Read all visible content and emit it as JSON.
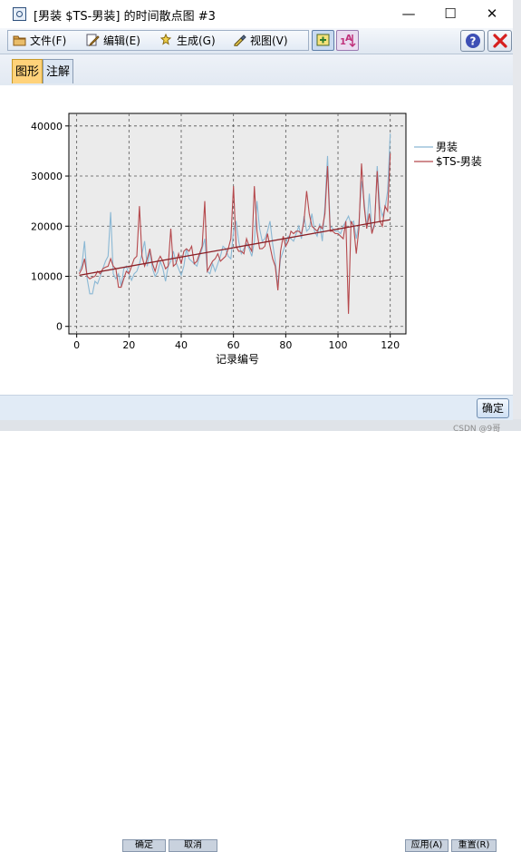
{
  "window": {
    "title": "[男装 $TS-男装] 的时间散点图 #3",
    "controls": {
      "minimize": "—",
      "maximize": "☐",
      "close": "✕"
    }
  },
  "menu": {
    "items": [
      {
        "label": "文件(F)",
        "icon": "folder-icon"
      },
      {
        "label": "编辑(E)",
        "icon": "edit-icon"
      },
      {
        "label": "生成(G)",
        "icon": "generate-icon"
      },
      {
        "label": "视图(V)",
        "icon": "view-icon"
      }
    ],
    "toolbar_buttons": [
      "chart-add-icon",
      "sort-icon"
    ],
    "help": "?",
    "close": "✕"
  },
  "tabs": [
    {
      "label": "图形",
      "active": true
    },
    {
      "label": "注解",
      "active": false
    }
  ],
  "chart_data": {
    "type": "line",
    "xlabel": "记录编号",
    "ylabel": "",
    "xlim": [
      -3,
      126
    ],
    "ylim": [
      -1500,
      42500
    ],
    "xticks": [
      0,
      20,
      40,
      60,
      80,
      100,
      120
    ],
    "yticks": [
      0,
      10000,
      20000,
      30000,
      40000
    ],
    "grid": true,
    "legend_position": "right",
    "series": [
      {
        "name": "男装",
        "color": "#8bb8d4",
        "x": [
          1,
          2,
          3,
          4,
          5,
          6,
          7,
          8,
          9,
          10,
          11,
          12,
          13,
          14,
          15,
          16,
          17,
          18,
          19,
          20,
          21,
          22,
          23,
          24,
          25,
          26,
          27,
          28,
          29,
          30,
          31,
          32,
          33,
          34,
          35,
          36,
          37,
          38,
          39,
          40,
          41,
          42,
          43,
          44,
          45,
          46,
          47,
          48,
          49,
          50,
          51,
          52,
          53,
          54,
          55,
          56,
          57,
          58,
          59,
          60,
          61,
          62,
          63,
          64,
          65,
          66,
          67,
          68,
          69,
          70,
          71,
          72,
          73,
          74,
          75,
          76,
          77,
          78,
          79,
          80,
          81,
          82,
          83,
          84,
          85,
          86,
          87,
          88,
          89,
          90,
          91,
          92,
          93,
          94,
          95,
          96,
          97,
          98,
          99,
          100,
          101,
          102,
          103,
          104,
          105,
          106,
          107,
          108,
          109,
          110,
          111,
          112,
          113,
          114,
          115,
          116,
          117,
          118,
          119,
          120
        ],
        "values": [
          11000,
          12200,
          17000,
          9500,
          6500,
          6500,
          9000,
          8500,
          10000,
          11500,
          13000,
          14000,
          22800,
          10500,
          9500,
          10500,
          8000,
          11500,
          12000,
          10500,
          9200,
          10500,
          11000,
          12500,
          14500,
          17000,
          12000,
          15000,
          11500,
          10000,
          10800,
          13000,
          11500,
          9000,
          12000,
          13000,
          15000,
          12800,
          11500,
          10200,
          12000,
          15500,
          13500,
          13000,
          12500,
          12000,
          14000,
          15500,
          17500,
          11000,
          10500,
          12500,
          11000,
          12500,
          14000,
          16000,
          15500,
          14000,
          13500,
          19000,
          21000,
          17000,
          14500,
          15500,
          16500,
          15500,
          14000,
          17000,
          25000,
          19500,
          17000,
          17500,
          19000,
          21000,
          16500,
          13000,
          8000,
          13500,
          15000,
          16500,
          18000,
          17500,
          17000,
          18500,
          20000,
          17500,
          22000,
          19000,
          19500,
          22500,
          19000,
          18000,
          20500,
          17000,
          24000,
          34000,
          20000,
          19500,
          19000,
          19000,
          18500,
          20000,
          21000,
          22000,
          20500,
          21000,
          17500,
          20500,
          29000,
          25000,
          19500,
          26500,
          19000,
          20000,
          32000,
          24000,
          22000,
          23500,
          27000,
          38500
        ]
      },
      {
        "name": "$TS-男装",
        "color": "#b5484c",
        "x": [
          1,
          2,
          3,
          4,
          5,
          6,
          7,
          8,
          9,
          10,
          11,
          12,
          13,
          14,
          15,
          16,
          17,
          18,
          19,
          20,
          21,
          22,
          23,
          24,
          25,
          26,
          27,
          28,
          29,
          30,
          31,
          32,
          33,
          34,
          35,
          36,
          37,
          38,
          39,
          40,
          41,
          42,
          43,
          44,
          45,
          46,
          47,
          48,
          49,
          50,
          51,
          52,
          53,
          54,
          55,
          56,
          57,
          58,
          59,
          60,
          61,
          62,
          63,
          64,
          65,
          66,
          67,
          68,
          69,
          70,
          71,
          72,
          73,
          74,
          75,
          76,
          77,
          78,
          79,
          80,
          81,
          82,
          83,
          84,
          85,
          86,
          87,
          88,
          89,
          90,
          91,
          92,
          93,
          94,
          95,
          96,
          97,
          98,
          99,
          100,
          101,
          102,
          103,
          104,
          105,
          106,
          107,
          108,
          109,
          110,
          111,
          112,
          113,
          114,
          115,
          116,
          117,
          118,
          119,
          120
        ],
        "values": [
          10500,
          11500,
          13500,
          10000,
          9500,
          9800,
          10000,
          11000,
          10500,
          11500,
          11800,
          12000,
          13500,
          12000,
          11500,
          7800,
          7800,
          9500,
          11000,
          10500,
          12000,
          13500,
          14000,
          24000,
          14000,
          12000,
          13500,
          15500,
          12500,
          11000,
          13000,
          14000,
          13000,
          11500,
          12000,
          19500,
          12000,
          12500,
          14500,
          12500,
          15000,
          15500,
          15000,
          16000,
          12500,
          13000,
          14500,
          16000,
          25000,
          11000,
          12000,
          13000,
          13500,
          14500,
          13000,
          13500,
          14000,
          15500,
          17500,
          28000,
          16000,
          15000,
          15000,
          14500,
          17500,
          16000,
          15000,
          28000,
          19000,
          15500,
          15500,
          16000,
          18500,
          16000,
          13500,
          12000,
          7200,
          15000,
          18000,
          16000,
          17000,
          19000,
          18500,
          19000,
          19000,
          18500,
          21000,
          27000,
          22500,
          20000,
          19500,
          19000,
          20000,
          19500,
          22500,
          32000,
          19000,
          19000,
          18500,
          18500,
          18000,
          17500,
          21000,
          2500,
          21000,
          20000,
          14500,
          19500,
          32500,
          24000,
          19500,
          22500,
          18500,
          20500,
          31000,
          21000,
          20000,
          24000,
          23000,
          34500
        ]
      },
      {
        "name": "",
        "color": "#8a1f25",
        "x": [
          1,
          120
        ],
        "values": [
          10200,
          21300
        ]
      }
    ]
  },
  "footer": {
    "ok": "确定"
  },
  "background": {
    "buttons": [
      "确定",
      "取消",
      "应用(A)",
      "重置(R)"
    ],
    "watermark": "CSDN @9哥"
  }
}
